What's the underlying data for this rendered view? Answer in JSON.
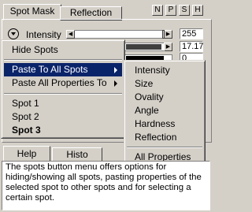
{
  "tabs": {
    "spot_mask": "Spot Mask",
    "reflection": "Reflection"
  },
  "top_buttons": [
    "N",
    "P",
    "S",
    "H"
  ],
  "intensity": {
    "label": "Intensity",
    "value": "255"
  },
  "row2": {
    "value": "17.17"
  },
  "row3": {
    "value": "0"
  },
  "spots_menu": {
    "hide_spots": "Hide Spots",
    "paste_to_all_spots": "Paste To All Spots",
    "paste_all_properties_to": "Paste All Properties To",
    "spot1": "Spot 1",
    "spot2": "Spot 2",
    "spot3": "Spot 3"
  },
  "submenu": {
    "items": [
      "Intensity",
      "Size",
      "Ovality",
      "Angle",
      "Hardness",
      "Reflection"
    ],
    "all_properties": "All Properties"
  },
  "bottom_tabs": {
    "help": "Help",
    "histo": "Histo"
  },
  "help_text": "The spots button menu offers options for hiding/showing all spots, pasting properties of the selected spot to other spots and for selecting a certain spot."
}
